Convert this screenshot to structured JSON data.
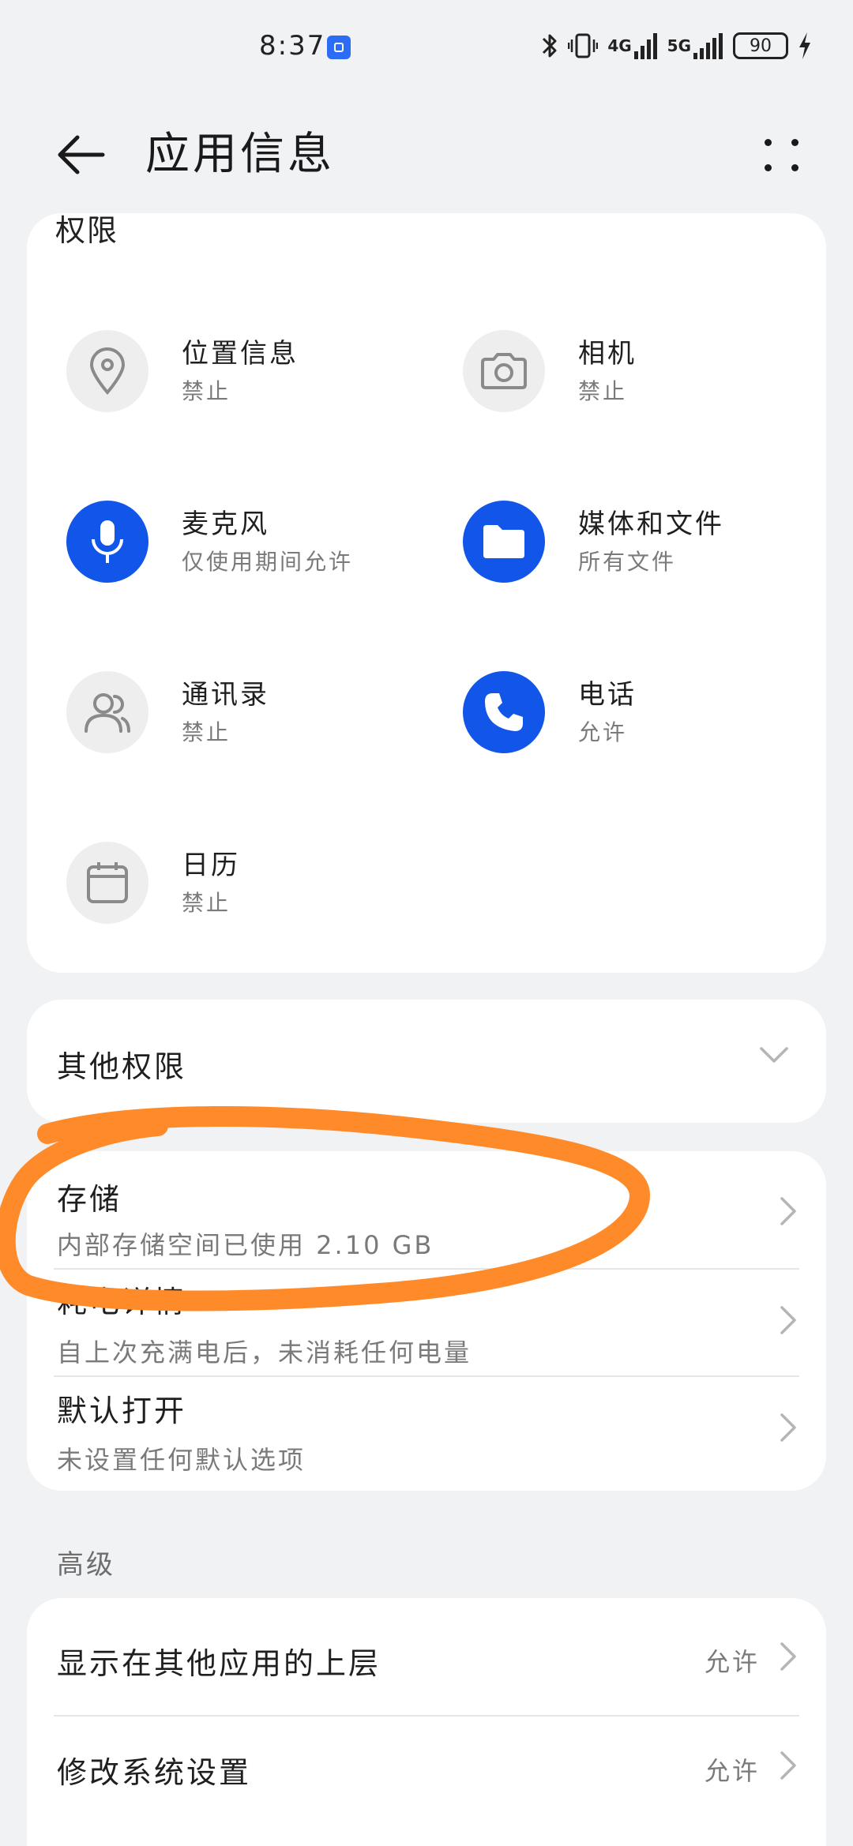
{
  "status_bar": {
    "time": "8:37",
    "net1": "4G",
    "net2": "5G",
    "battery": "90"
  },
  "header": {
    "title": "应用信息"
  },
  "permissions": {
    "header": "权限",
    "items": [
      {
        "label": "位置信息",
        "status": "禁止",
        "icon": "location-icon",
        "active": false
      },
      {
        "label": "相机",
        "status": "禁止",
        "icon": "camera-icon",
        "active": false
      },
      {
        "label": "麦克风",
        "status": "仅使用期间允许",
        "icon": "microphone-icon",
        "active": true
      },
      {
        "label": "媒体和文件",
        "status": "所有文件",
        "icon": "folder-icon",
        "active": true
      },
      {
        "label": "通讯录",
        "status": "禁止",
        "icon": "contacts-icon",
        "active": false
      },
      {
        "label": "电话",
        "status": "允许",
        "icon": "phone-icon",
        "active": true
      },
      {
        "label": "日历",
        "status": "禁止",
        "icon": "calendar-icon",
        "active": false
      }
    ]
  },
  "other_permissions": {
    "label": "其他权限"
  },
  "info_rows": [
    {
      "title": "存储",
      "subtitle": "内部存储空间已使用 2.10 GB"
    },
    {
      "title": "耗电详情",
      "subtitle": "自上次充满电后，未消耗任何电量"
    },
    {
      "title": "默认打开",
      "subtitle": "未设置任何默认选项"
    }
  ],
  "advanced": {
    "section_label": "高级",
    "rows": [
      {
        "title": "显示在其他应用的上层",
        "value": "允许"
      },
      {
        "title": "修改系统设置",
        "value": "允许"
      }
    ]
  },
  "colors": {
    "accent": "#1156e8",
    "annotation": "#ff8a2a",
    "background": "#f1f2f4"
  }
}
